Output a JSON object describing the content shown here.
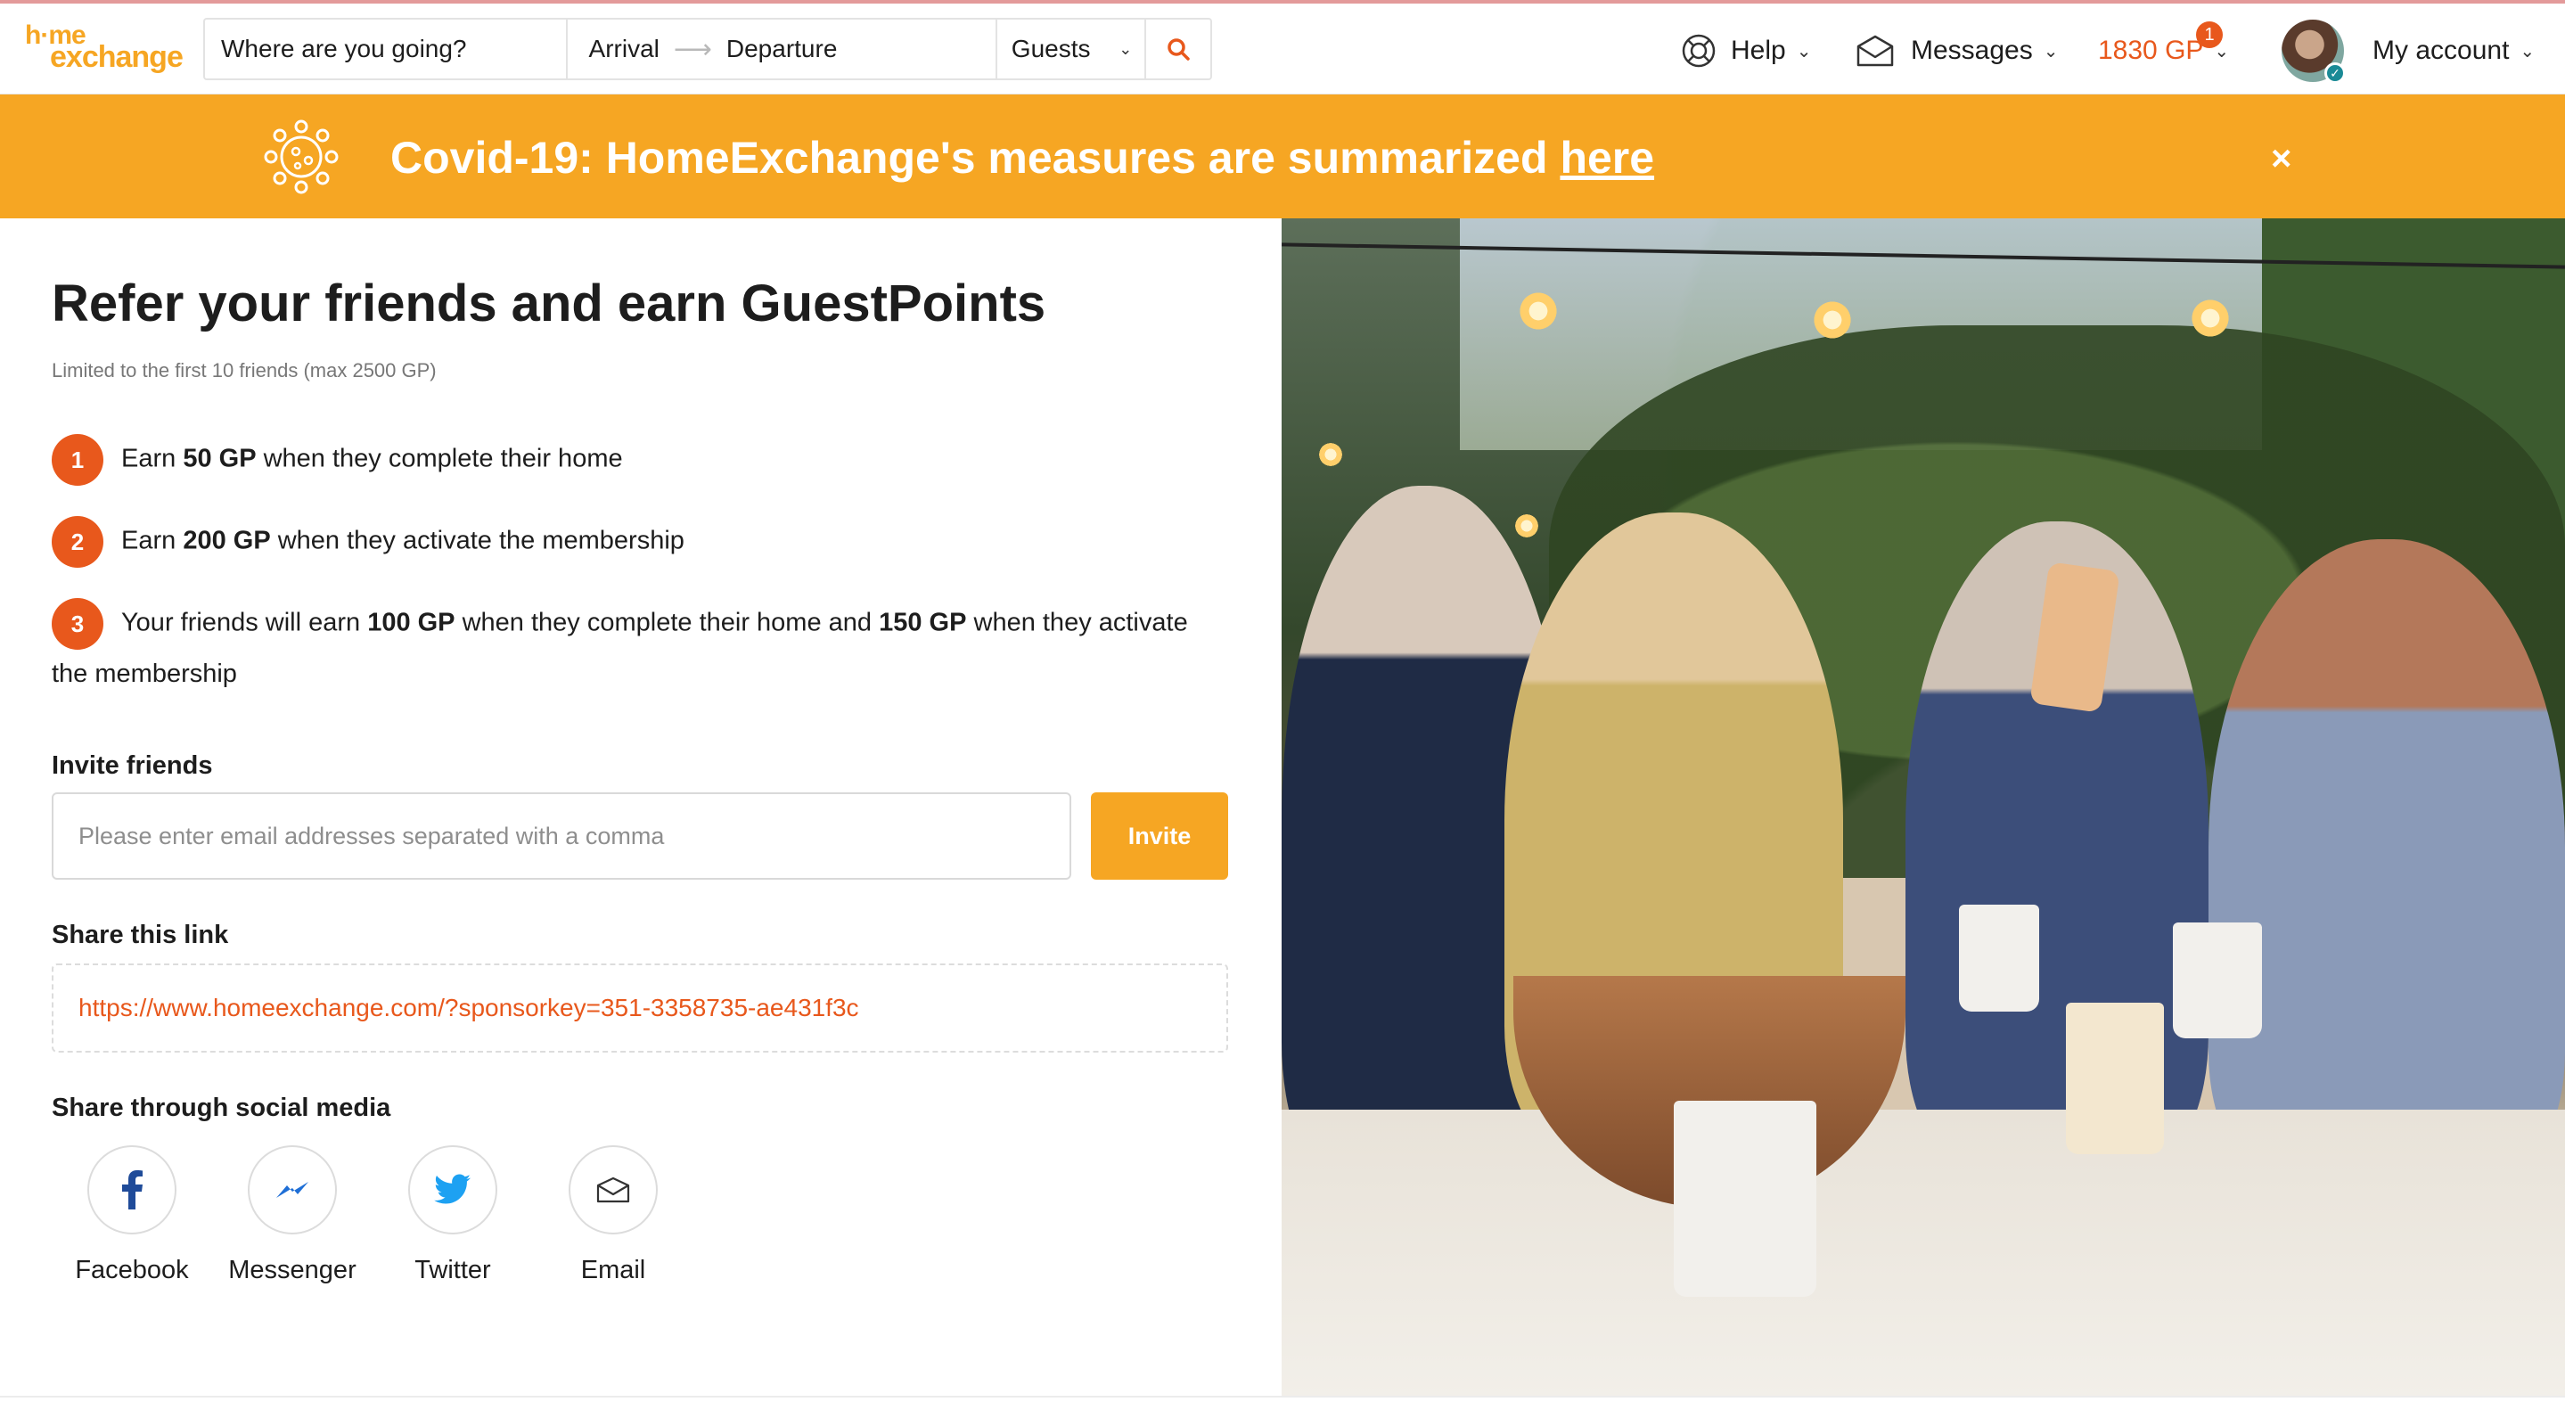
{
  "header": {
    "logo_line1": "h·me",
    "logo_line2": "exchange",
    "search": {
      "where_placeholder": "Where are you going?",
      "arrival": "Arrival",
      "departure": "Departure",
      "guests": "Guests"
    },
    "help": "Help",
    "messages": "Messages",
    "guestpoints": "1830 GP",
    "guestpoints_badge": "1",
    "account": "My account"
  },
  "banner": {
    "text": "Covid-19: HomeExchange's measures are summarized ",
    "link": "here",
    "close": "×"
  },
  "referral": {
    "title": "Refer your friends and earn GuestPoints",
    "subtitle": "Limited to the first 10 friends (max 2500 GP)",
    "steps": [
      {
        "num": "1",
        "pre": "Earn ",
        "bold": "50 GP",
        "post": " when they complete their home"
      },
      {
        "num": "2",
        "pre": "Earn ",
        "bold": "200 GP",
        "post": " when they activate the membership"
      },
      {
        "num": "3",
        "pre": "Your friends will earn ",
        "bold": "100 GP",
        "mid": " when they complete their home and ",
        "bold2": "150 GP",
        "post": " when they activate the membership"
      }
    ],
    "invite_label": "Invite friends",
    "invite_placeholder": "Please enter email addresses separated with a comma",
    "invite_button": "Invite",
    "share_label": "Share this link",
    "share_link": "https://www.homeexchange.com/?sponsorkey=351-3358735-ae431f3c",
    "social_label": "Share through social media",
    "social": [
      {
        "label": "Facebook",
        "icon": "facebook-icon"
      },
      {
        "label": "Messenger",
        "icon": "messenger-icon"
      },
      {
        "label": "Twitter",
        "icon": "twitter-icon"
      },
      {
        "label": "Email",
        "icon": "email-icon"
      }
    ]
  },
  "colors": {
    "brand_orange": "#f6a623",
    "accent_red_orange": "#e8581c",
    "facebook_blue": "#1f4b99",
    "twitter_blue": "#1da1f2"
  }
}
